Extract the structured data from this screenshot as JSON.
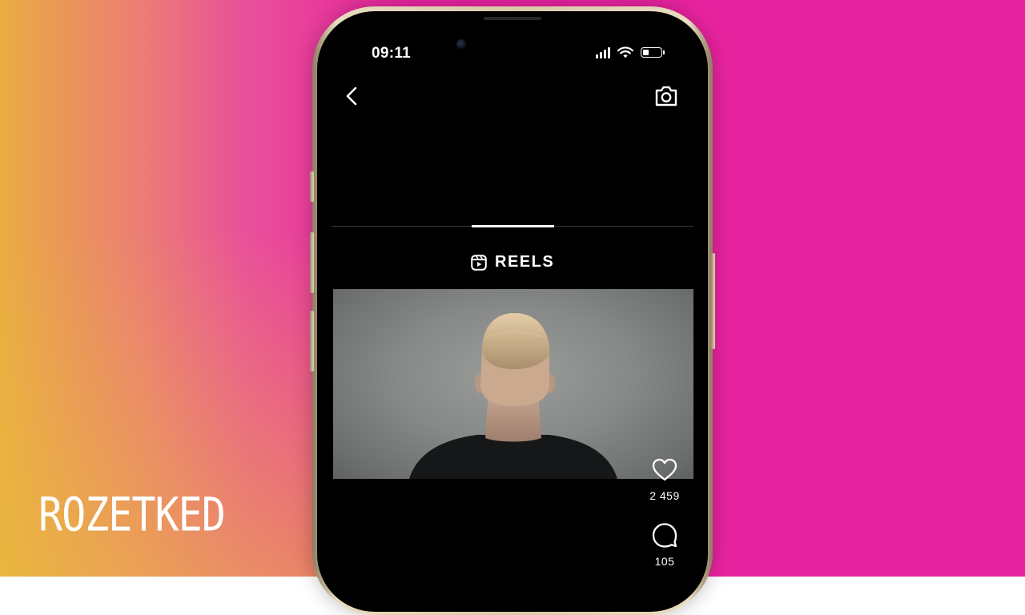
{
  "watermark": {
    "brand": "ROZETKED"
  },
  "status_bar": {
    "time": "09:11",
    "battery_level": 0.35
  },
  "top_nav": {
    "back_icon": "chevron-left-icon",
    "camera_icon": "camera-icon"
  },
  "section": {
    "icon": "reels-icon",
    "title": "REELS"
  },
  "reel": {
    "content": "video-thumbnail",
    "likes": "2 459",
    "comments": "105"
  },
  "colors": {
    "screen_bg": "#000000",
    "text": "#ffffff",
    "background_pink": "#e8239f",
    "background_orange": "#e9b43c",
    "phone_frame": "#d7c9aa"
  }
}
